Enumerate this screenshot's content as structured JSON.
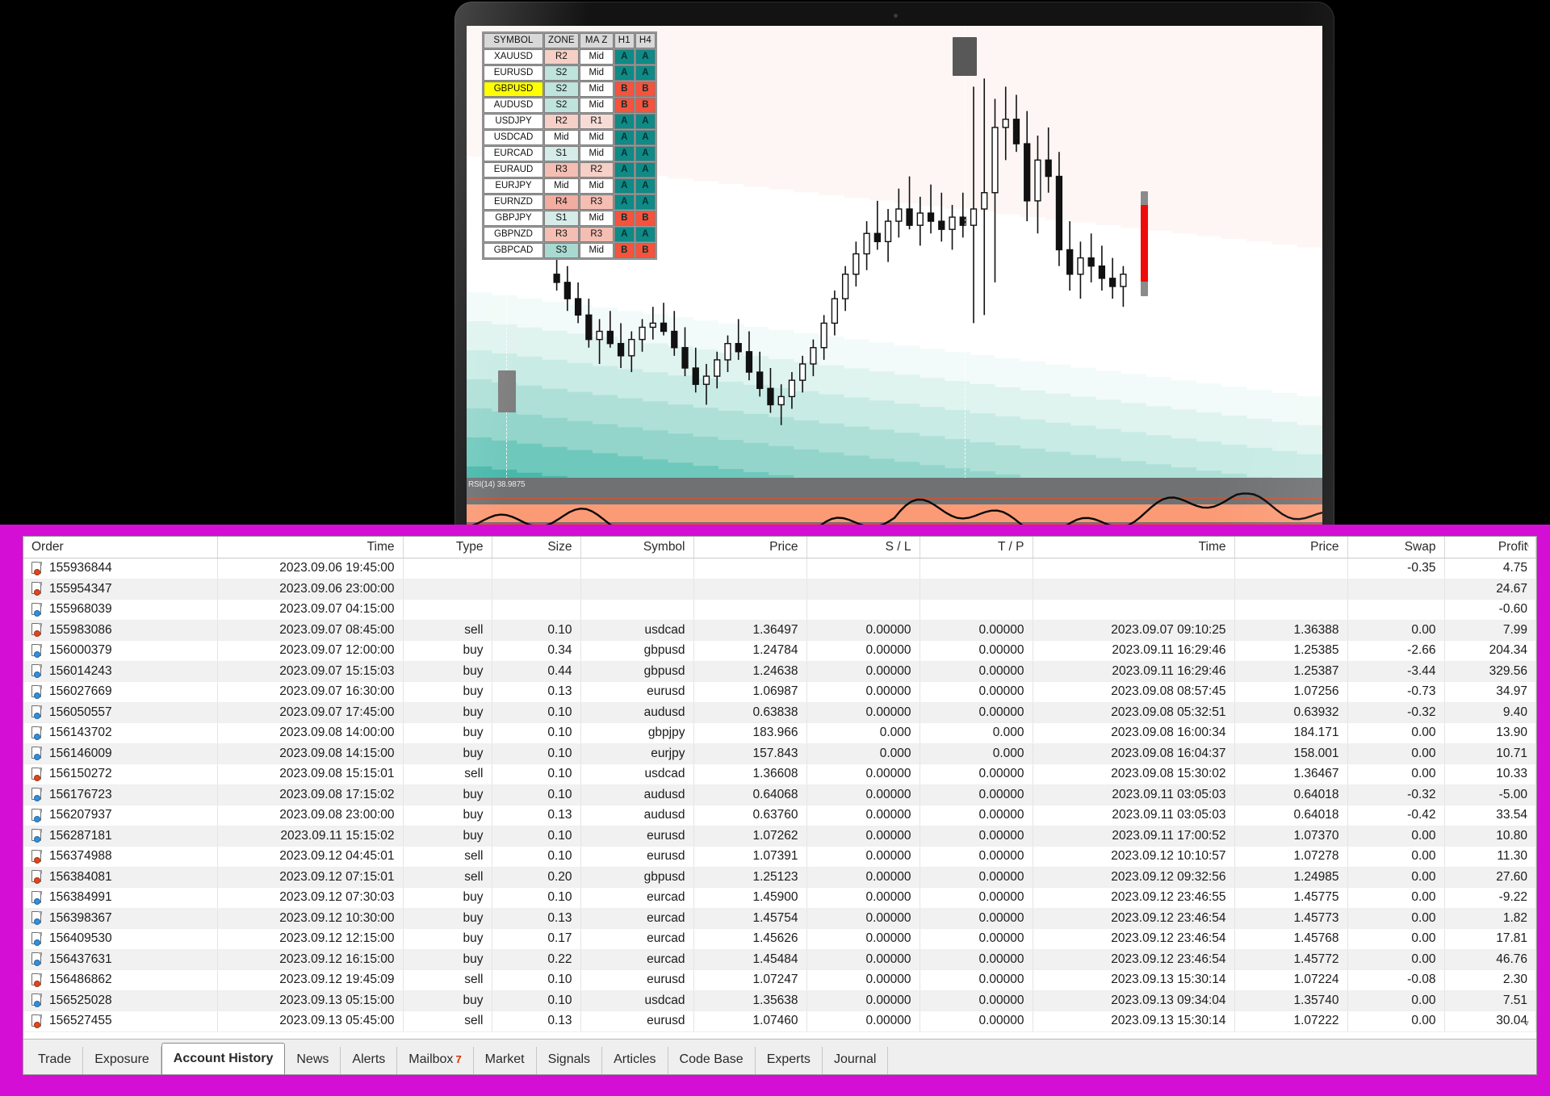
{
  "device": {
    "label": "MacBook Pro"
  },
  "accent": {
    "magenta": "#d40ed4",
    "buy_dot": "#2f8fe0",
    "sell_dot": "#e2461c",
    "signal_a_bg": "#0f8a86",
    "signal_b_bg": "#f5533d",
    "highlight_row": "#ffff00"
  },
  "dashboard": {
    "name": "symbol-zone-dashboard",
    "columns": [
      "SYMBOL",
      "ZONE",
      "MA Z",
      "H1",
      "H4"
    ],
    "rows": [
      {
        "symbol": "XAUUSD",
        "zone": "R2",
        "maz": "Mid",
        "h1": "A",
        "h4": "A",
        "highlight": false
      },
      {
        "symbol": "EURUSD",
        "zone": "S2",
        "maz": "Mid",
        "h1": "A",
        "h4": "A",
        "highlight": false
      },
      {
        "symbol": "GBPUSD",
        "zone": "S2",
        "maz": "Mid",
        "h1": "B",
        "h4": "B",
        "highlight": true
      },
      {
        "symbol": "AUDUSD",
        "zone": "S2",
        "maz": "Mid",
        "h1": "B",
        "h4": "B",
        "highlight": false
      },
      {
        "symbol": "USDJPY",
        "zone": "R2",
        "maz": "R1",
        "h1": "A",
        "h4": "A",
        "highlight": false
      },
      {
        "symbol": "USDCAD",
        "zone": "Mid",
        "maz": "Mid",
        "h1": "A",
        "h4": "A",
        "highlight": false
      },
      {
        "symbol": "EURCAD",
        "zone": "S1",
        "maz": "Mid",
        "h1": "A",
        "h4": "A",
        "highlight": false
      },
      {
        "symbol": "EURAUD",
        "zone": "R3",
        "maz": "R2",
        "h1": "A",
        "h4": "A",
        "highlight": false
      },
      {
        "symbol": "EURJPY",
        "zone": "Mid",
        "maz": "Mid",
        "h1": "A",
        "h4": "A",
        "highlight": false
      },
      {
        "symbol": "EURNZD",
        "zone": "R4",
        "maz": "R3",
        "h1": "A",
        "h4": "A",
        "highlight": false
      },
      {
        "symbol": "GBPJPY",
        "zone": "S1",
        "maz": "Mid",
        "h1": "B",
        "h4": "B",
        "highlight": false
      },
      {
        "symbol": "GBPNZD",
        "zone": "R3",
        "maz": "R3",
        "h1": "A",
        "h4": "A",
        "highlight": false
      },
      {
        "symbol": "GBPCAD",
        "zone": "S3",
        "maz": "Mid",
        "h1": "B",
        "h4": "B",
        "highlight": false
      }
    ]
  },
  "indicator": {
    "rsi_label": "RSI(14) 38.9875"
  },
  "history": {
    "columns": [
      "Order",
      "Time",
      "Type",
      "Size",
      "Symbol",
      "Price",
      "S / L",
      "T / P",
      "Time",
      "Price",
      "Swap",
      "Profit"
    ],
    "rows": [
      {
        "order": "155936844",
        "time": "2023.09.06 19:45:00",
        "type": "",
        "size": "",
        "symbol": "",
        "price": "",
        "sl": "",
        "tp": "",
        "ctime": "",
        "cprice": "",
        "swap": "-0.35",
        "profit": "4.75",
        "side": "sell"
      },
      {
        "order": "155954347",
        "time": "2023.09.06 23:00:00",
        "type": "",
        "size": "",
        "symbol": "",
        "price": "",
        "sl": "",
        "tp": "",
        "ctime": "",
        "cprice": "",
        "swap": "",
        "profit": "24.67",
        "side": "sell"
      },
      {
        "order": "155968039",
        "time": "2023.09.07 04:15:00",
        "type": "",
        "size": "",
        "symbol": "",
        "price": "",
        "sl": "",
        "tp": "",
        "ctime": "",
        "cprice": "",
        "swap": "",
        "profit": "-0.60",
        "side": "buy"
      },
      {
        "order": "155983086",
        "time": "2023.09.07 08:45:00",
        "type": "sell",
        "size": "0.10",
        "symbol": "usdcad",
        "price": "1.36497",
        "sl": "0.00000",
        "tp": "0.00000",
        "ctime": "2023.09.07 09:10:25",
        "cprice": "1.36388",
        "swap": "0.00",
        "profit": "7.99",
        "side": "sell"
      },
      {
        "order": "156000379",
        "time": "2023.09.07 12:00:00",
        "type": "buy",
        "size": "0.34",
        "symbol": "gbpusd",
        "price": "1.24784",
        "sl": "0.00000",
        "tp": "0.00000",
        "ctime": "2023.09.11 16:29:46",
        "cprice": "1.25385",
        "swap": "-2.66",
        "profit": "204.34",
        "side": "buy"
      },
      {
        "order": "156014243",
        "time": "2023.09.07 15:15:03",
        "type": "buy",
        "size": "0.44",
        "symbol": "gbpusd",
        "price": "1.24638",
        "sl": "0.00000",
        "tp": "0.00000",
        "ctime": "2023.09.11 16:29:46",
        "cprice": "1.25387",
        "swap": "-3.44",
        "profit": "329.56",
        "side": "buy"
      },
      {
        "order": "156027669",
        "time": "2023.09.07 16:30:00",
        "type": "buy",
        "size": "0.13",
        "symbol": "eurusd",
        "price": "1.06987",
        "sl": "0.00000",
        "tp": "0.00000",
        "ctime": "2023.09.08 08:57:45",
        "cprice": "1.07256",
        "swap": "-0.73",
        "profit": "34.97",
        "side": "buy"
      },
      {
        "order": "156050557",
        "time": "2023.09.07 17:45:00",
        "type": "buy",
        "size": "0.10",
        "symbol": "audusd",
        "price": "0.63838",
        "sl": "0.00000",
        "tp": "0.00000",
        "ctime": "2023.09.08 05:32:51",
        "cprice": "0.63932",
        "swap": "-0.32",
        "profit": "9.40",
        "side": "buy"
      },
      {
        "order": "156143702",
        "time": "2023.09.08 14:00:00",
        "type": "buy",
        "size": "0.10",
        "symbol": "gbpjpy",
        "price": "183.966",
        "sl": "0.000",
        "tp": "0.000",
        "ctime": "2023.09.08 16:00:34",
        "cprice": "184.171",
        "swap": "0.00",
        "profit": "13.90",
        "side": "buy"
      },
      {
        "order": "156146009",
        "time": "2023.09.08 14:15:00",
        "type": "buy",
        "size": "0.10",
        "symbol": "eurjpy",
        "price": "157.843",
        "sl": "0.000",
        "tp": "0.000",
        "ctime": "2023.09.08 16:04:37",
        "cprice": "158.001",
        "swap": "0.00",
        "profit": "10.71",
        "side": "buy"
      },
      {
        "order": "156150272",
        "time": "2023.09.08 15:15:01",
        "type": "sell",
        "size": "0.10",
        "symbol": "usdcad",
        "price": "1.36608",
        "sl": "0.00000",
        "tp": "0.00000",
        "ctime": "2023.09.08 15:30:02",
        "cprice": "1.36467",
        "swap": "0.00",
        "profit": "10.33",
        "side": "sell"
      },
      {
        "order": "156176723",
        "time": "2023.09.08 17:15:02",
        "type": "buy",
        "size": "0.10",
        "symbol": "audusd",
        "price": "0.64068",
        "sl": "0.00000",
        "tp": "0.00000",
        "ctime": "2023.09.11 03:05:03",
        "cprice": "0.64018",
        "swap": "-0.32",
        "profit": "-5.00",
        "side": "buy"
      },
      {
        "order": "156207937",
        "time": "2023.09.08 23:00:00",
        "type": "buy",
        "size": "0.13",
        "symbol": "audusd",
        "price": "0.63760",
        "sl": "0.00000",
        "tp": "0.00000",
        "ctime": "2023.09.11 03:05:03",
        "cprice": "0.64018",
        "swap": "-0.42",
        "profit": "33.54",
        "side": "buy"
      },
      {
        "order": "156287181",
        "time": "2023.09.11 15:15:02",
        "type": "buy",
        "size": "0.10",
        "symbol": "eurusd",
        "price": "1.07262",
        "sl": "0.00000",
        "tp": "0.00000",
        "ctime": "2023.09.11 17:00:52",
        "cprice": "1.07370",
        "swap": "0.00",
        "profit": "10.80",
        "side": "buy"
      },
      {
        "order": "156374988",
        "time": "2023.09.12 04:45:01",
        "type": "sell",
        "size": "0.10",
        "symbol": "eurusd",
        "price": "1.07391",
        "sl": "0.00000",
        "tp": "0.00000",
        "ctime": "2023.09.12 10:10:57",
        "cprice": "1.07278",
        "swap": "0.00",
        "profit": "11.30",
        "side": "sell"
      },
      {
        "order": "156384081",
        "time": "2023.09.12 07:15:01",
        "type": "sell",
        "size": "0.20",
        "symbol": "gbpusd",
        "price": "1.25123",
        "sl": "0.00000",
        "tp": "0.00000",
        "ctime": "2023.09.12 09:32:56",
        "cprice": "1.24985",
        "swap": "0.00",
        "profit": "27.60",
        "side": "sell"
      },
      {
        "order": "156384991",
        "time": "2023.09.12 07:30:03",
        "type": "buy",
        "size": "0.10",
        "symbol": "eurcad",
        "price": "1.45900",
        "sl": "0.00000",
        "tp": "0.00000",
        "ctime": "2023.09.12 23:46:55",
        "cprice": "1.45775",
        "swap": "0.00",
        "profit": "-9.22",
        "side": "buy"
      },
      {
        "order": "156398367",
        "time": "2023.09.12 10:30:00",
        "type": "buy",
        "size": "0.13",
        "symbol": "eurcad",
        "price": "1.45754",
        "sl": "0.00000",
        "tp": "0.00000",
        "ctime": "2023.09.12 23:46:54",
        "cprice": "1.45773",
        "swap": "0.00",
        "profit": "1.82",
        "side": "buy"
      },
      {
        "order": "156409530",
        "time": "2023.09.12 12:15:00",
        "type": "buy",
        "size": "0.17",
        "symbol": "eurcad",
        "price": "1.45626",
        "sl": "0.00000",
        "tp": "0.00000",
        "ctime": "2023.09.12 23:46:54",
        "cprice": "1.45768",
        "swap": "0.00",
        "profit": "17.81",
        "side": "buy"
      },
      {
        "order": "156437631",
        "time": "2023.09.12 16:15:00",
        "type": "buy",
        "size": "0.22",
        "symbol": "eurcad",
        "price": "1.45484",
        "sl": "0.00000",
        "tp": "0.00000",
        "ctime": "2023.09.12 23:46:54",
        "cprice": "1.45772",
        "swap": "0.00",
        "profit": "46.76",
        "side": "buy"
      },
      {
        "order": "156486862",
        "time": "2023.09.12 19:45:09",
        "type": "sell",
        "size": "0.10",
        "symbol": "eurusd",
        "price": "1.07247",
        "sl": "0.00000",
        "tp": "0.00000",
        "ctime": "2023.09.13 15:30:14",
        "cprice": "1.07224",
        "swap": "-0.08",
        "profit": "2.30",
        "side": "sell"
      },
      {
        "order": "156525028",
        "time": "2023.09.13 05:15:00",
        "type": "buy",
        "size": "0.10",
        "symbol": "usdcad",
        "price": "1.35638",
        "sl": "0.00000",
        "tp": "0.00000",
        "ctime": "2023.09.13 09:34:04",
        "cprice": "1.35740",
        "swap": "0.00",
        "profit": "7.51",
        "side": "buy"
      },
      {
        "order": "156527455",
        "time": "2023.09.13 05:45:00",
        "type": "sell",
        "size": "0.13",
        "symbol": "eurusd",
        "price": "1.07460",
        "sl": "0.00000",
        "tp": "0.00000",
        "ctime": "2023.09.13 15:30:14",
        "cprice": "1.07222",
        "swap": "0.00",
        "profit": "30.04",
        "side": "sell"
      }
    ]
  },
  "tabs": [
    {
      "label": "Trade",
      "active": false,
      "badge": ""
    },
    {
      "label": "Exposure",
      "active": false,
      "badge": ""
    },
    {
      "label": "Account History",
      "active": true,
      "badge": ""
    },
    {
      "label": "News",
      "active": false,
      "badge": ""
    },
    {
      "label": "Alerts",
      "active": false,
      "badge": ""
    },
    {
      "label": "Mailbox",
      "active": false,
      "badge": "7"
    },
    {
      "label": "Market",
      "active": false,
      "badge": ""
    },
    {
      "label": "Signals",
      "active": false,
      "badge": ""
    },
    {
      "label": "Articles",
      "active": false,
      "badge": ""
    },
    {
      "label": "Code Base",
      "active": false,
      "badge": ""
    },
    {
      "label": "Experts",
      "active": false,
      "badge": ""
    },
    {
      "label": "Journal",
      "active": false,
      "badge": ""
    }
  ],
  "scroll": {
    "up": "˄",
    "down": "˅"
  },
  "chart_data": {
    "type": "candlestick",
    "title": "",
    "xlabel": "",
    "ylabel": "",
    "indicator": {
      "name": "RSI",
      "period": 14,
      "value": 38.9875
    },
    "zone_bands_resistance": [
      "R1",
      "R2",
      "R3",
      "R4"
    ],
    "zone_bands_support": [
      "S1",
      "S2",
      "S3",
      "S4"
    ],
    "candles": [
      {
        "o": 42,
        "h": 46,
        "l": 38,
        "c": 40
      },
      {
        "o": 40,
        "h": 44,
        "l": 33,
        "c": 36
      },
      {
        "o": 36,
        "h": 40,
        "l": 30,
        "c": 32
      },
      {
        "o": 32,
        "h": 36,
        "l": 24,
        "c": 26
      },
      {
        "o": 26,
        "h": 31,
        "l": 20,
        "c": 28
      },
      {
        "o": 28,
        "h": 33,
        "l": 24,
        "c": 25
      },
      {
        "o": 25,
        "h": 30,
        "l": 19,
        "c": 22
      },
      {
        "o": 22,
        "h": 28,
        "l": 18,
        "c": 26
      },
      {
        "o": 26,
        "h": 31,
        "l": 23,
        "c": 29
      },
      {
        "o": 29,
        "h": 34,
        "l": 26,
        "c": 30
      },
      {
        "o": 30,
        "h": 35,
        "l": 27,
        "c": 28
      },
      {
        "o": 28,
        "h": 33,
        "l": 22,
        "c": 24
      },
      {
        "o": 24,
        "h": 29,
        "l": 17,
        "c": 19
      },
      {
        "o": 19,
        "h": 24,
        "l": 13,
        "c": 15
      },
      {
        "o": 15,
        "h": 20,
        "l": 10,
        "c": 17
      },
      {
        "o": 17,
        "h": 23,
        "l": 14,
        "c": 21
      },
      {
        "o": 21,
        "h": 27,
        "l": 18,
        "c": 25
      },
      {
        "o": 25,
        "h": 31,
        "l": 21,
        "c": 23
      },
      {
        "o": 23,
        "h": 28,
        "l": 16,
        "c": 18
      },
      {
        "o": 18,
        "h": 23,
        "l": 12,
        "c": 14
      },
      {
        "o": 14,
        "h": 19,
        "l": 8,
        "c": 10
      },
      {
        "o": 10,
        "h": 15,
        "l": 5,
        "c": 12
      },
      {
        "o": 12,
        "h": 18,
        "l": 9,
        "c": 16
      },
      {
        "o": 16,
        "h": 22,
        "l": 13,
        "c": 20
      },
      {
        "o": 20,
        "h": 26,
        "l": 17,
        "c": 24
      },
      {
        "o": 24,
        "h": 32,
        "l": 21,
        "c": 30
      },
      {
        "o": 30,
        "h": 38,
        "l": 27,
        "c": 36
      },
      {
        "o": 36,
        "h": 44,
        "l": 33,
        "c": 42
      },
      {
        "o": 42,
        "h": 50,
        "l": 39,
        "c": 47
      },
      {
        "o": 47,
        "h": 55,
        "l": 43,
        "c": 52
      },
      {
        "o": 52,
        "h": 60,
        "l": 48,
        "c": 50
      },
      {
        "o": 50,
        "h": 58,
        "l": 45,
        "c": 55
      },
      {
        "o": 55,
        "h": 63,
        "l": 51,
        "c": 58
      },
      {
        "o": 58,
        "h": 66,
        "l": 53,
        "c": 54
      },
      {
        "o": 54,
        "h": 61,
        "l": 49,
        "c": 57
      },
      {
        "o": 57,
        "h": 64,
        "l": 52,
        "c": 55
      },
      {
        "o": 55,
        "h": 62,
        "l": 50,
        "c": 53
      },
      {
        "o": 53,
        "h": 59,
        "l": 48,
        "c": 56
      },
      {
        "o": 56,
        "h": 62,
        "l": 51,
        "c": 54
      },
      {
        "o": 54,
        "h": 88,
        "l": 30,
        "c": 58
      },
      {
        "o": 58,
        "h": 90,
        "l": 32,
        "c": 62
      },
      {
        "o": 62,
        "h": 85,
        "l": 40,
        "c": 78
      },
      {
        "o": 78,
        "h": 88,
        "l": 70,
        "c": 80
      },
      {
        "o": 80,
        "h": 86,
        "l": 72,
        "c": 74
      },
      {
        "o": 74,
        "h": 82,
        "l": 55,
        "c": 60
      },
      {
        "o": 60,
        "h": 76,
        "l": 52,
        "c": 70
      },
      {
        "o": 70,
        "h": 78,
        "l": 62,
        "c": 66
      },
      {
        "o": 66,
        "h": 72,
        "l": 44,
        "c": 48
      },
      {
        "o": 48,
        "h": 55,
        "l": 38,
        "c": 42
      },
      {
        "o": 42,
        "h": 50,
        "l": 36,
        "c": 46
      },
      {
        "o": 46,
        "h": 52,
        "l": 40,
        "c": 44
      },
      {
        "o": 44,
        "h": 49,
        "l": 38,
        "c": 41
      },
      {
        "o": 41,
        "h": 46,
        "l": 36,
        "c": 39
      },
      {
        "o": 39,
        "h": 44,
        "l": 34,
        "c": 42
      }
    ]
  }
}
